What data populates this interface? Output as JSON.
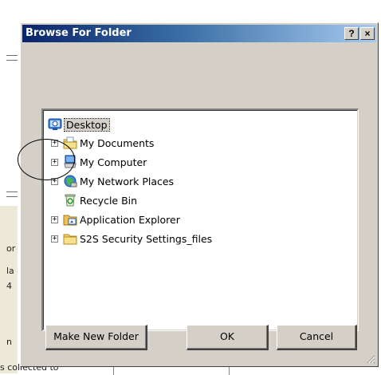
{
  "dialog": {
    "title": "Browse For Folder",
    "help_button": "?",
    "close_button": "×"
  },
  "tree": {
    "items": [
      {
        "label": "Desktop",
        "icon": "desktop-icon",
        "expandable": false,
        "selected": true
      },
      {
        "label": "My Documents",
        "icon": "my-documents-icon",
        "expandable": true
      },
      {
        "label": "My Computer",
        "icon": "my-computer-icon",
        "expandable": true
      },
      {
        "label": "My Network Places",
        "icon": "network-places-icon",
        "expandable": true
      },
      {
        "label": "Recycle Bin",
        "icon": "recycle-bin-icon",
        "expandable": false
      },
      {
        "label": "Application Explorer",
        "icon": "application-explorer-icon",
        "expandable": true
      },
      {
        "label": "S2S Security Settings_files",
        "icon": "folder-icon",
        "expandable": true
      }
    ],
    "expander_symbol": "+"
  },
  "buttons": {
    "make_new_folder": "Make New Folder",
    "ok": "OK",
    "cancel": "Cancel"
  },
  "background": {
    "frag1": "or",
    "frag2": "la",
    "frag3": "4",
    "frag4": "n",
    "bottom_text": "s collected to"
  },
  "colors": {
    "title_start": "#0a246a",
    "title_end": "#a6caf0",
    "dialog_face": "#d4d0c8"
  }
}
